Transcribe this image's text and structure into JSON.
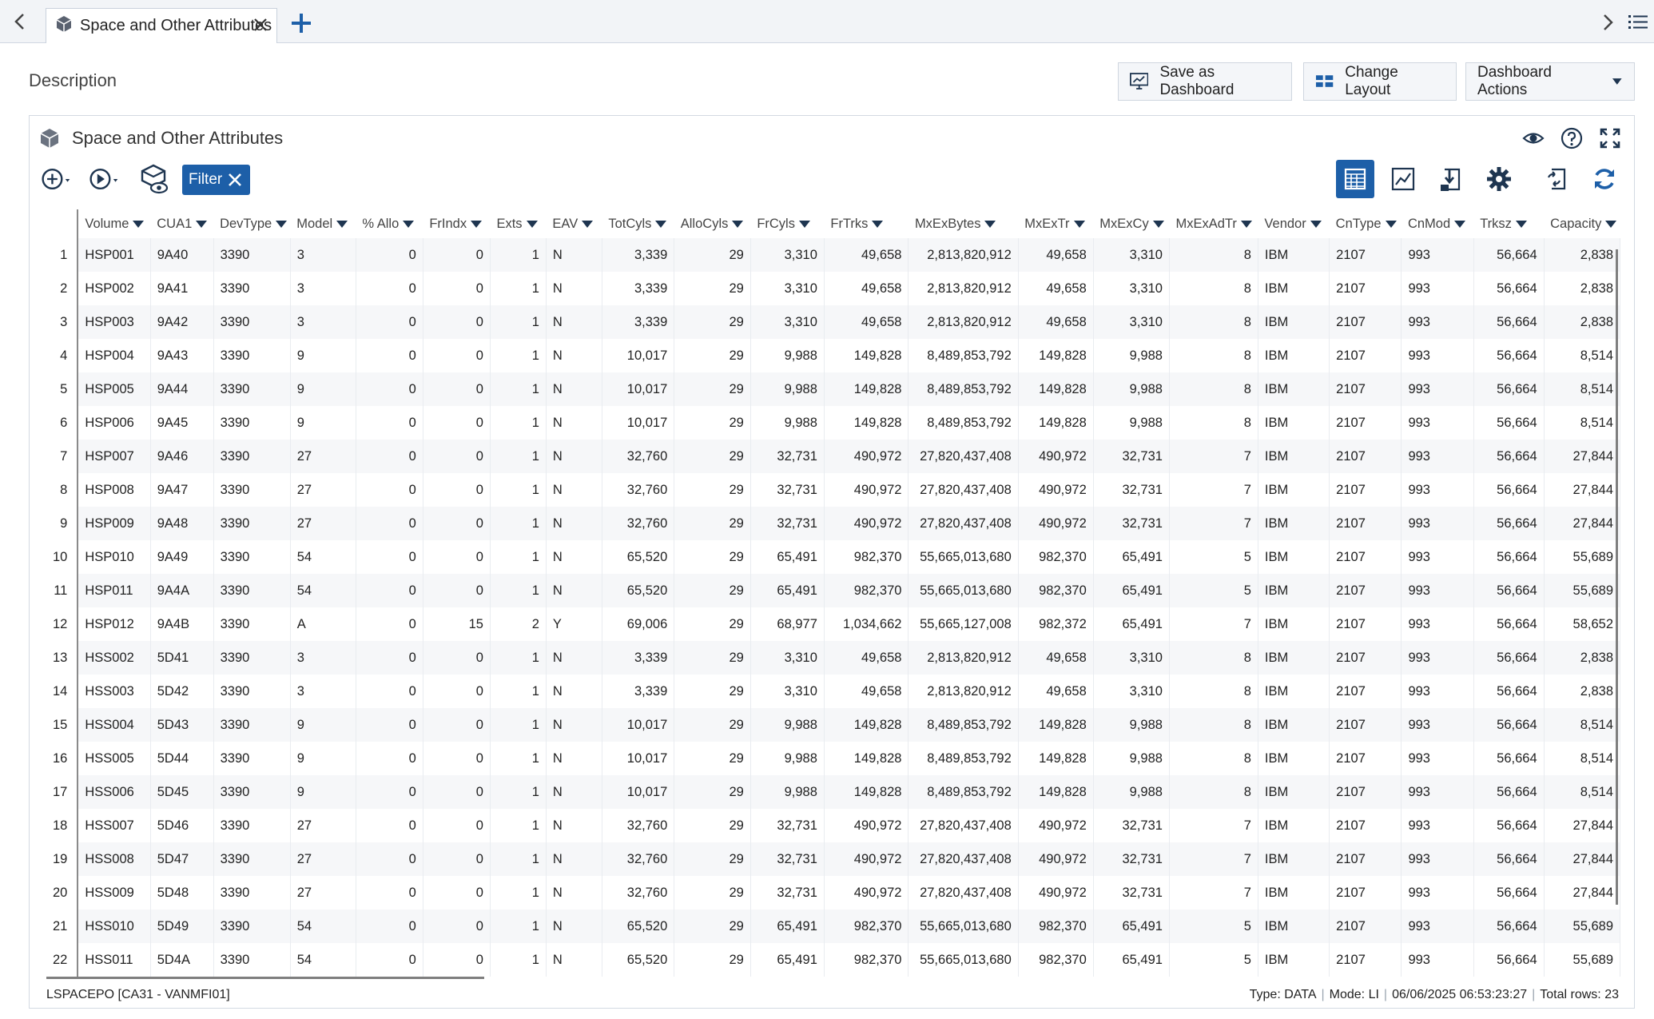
{
  "tab": {
    "title": "Space and Other Attributes"
  },
  "header": {
    "description_label": "Description",
    "save_dashboard_label": "Save as Dashboard",
    "change_layout_label": "Change Layout",
    "dashboard_actions_label": "Dashboard Actions"
  },
  "panel": {
    "title": "Space and Other Attributes",
    "filter_label": "Filter"
  },
  "colors": {
    "accent": "#1d5fa8",
    "icon_dark": "#1e3550"
  },
  "icons": {
    "tab_left": "chevron-left-icon",
    "tab_cube": "cube-icon",
    "tab_close": "close-icon",
    "tab_add": "plus-icon",
    "tab_right": "chevron-right-icon",
    "tab_list": "list-icon",
    "eye": "eye-icon",
    "help": "help-icon",
    "expand": "expand-icon",
    "add": "add-circle-icon",
    "run": "run-circle-icon",
    "view_object": "cube-eye-icon",
    "table_view": "table-icon",
    "chart_view": "chart-icon",
    "export": "export-icon",
    "settings": "gear-icon",
    "sync": "sync-icon",
    "refresh": "refresh-icon"
  },
  "table": {
    "columns": [
      "Volume",
      "CUA1",
      "DevType",
      "Model",
      "% Allo",
      "FrIndx",
      "Exts",
      "EAV",
      "TotCyls",
      "AlloCyls",
      "FrCyls",
      "FrTrks",
      "MxExBytes",
      "MxExTr",
      "MxExCy",
      "MxExAdTr",
      "Vendor",
      "CnType",
      "CnMod",
      "Trksz",
      "Capacity"
    ],
    "rows": [
      [
        "1",
        "HSP001",
        "9A40",
        "3390",
        "3",
        "0",
        "0",
        "1",
        "N",
        "3,339",
        "29",
        "3,310",
        "49,658",
        "2,813,820,912",
        "49,658",
        "3,310",
        "8",
        "IBM",
        "2107",
        "993",
        "56,664",
        "2,838"
      ],
      [
        "2",
        "HSP002",
        "9A41",
        "3390",
        "3",
        "0",
        "0",
        "1",
        "N",
        "3,339",
        "29",
        "3,310",
        "49,658",
        "2,813,820,912",
        "49,658",
        "3,310",
        "8",
        "IBM",
        "2107",
        "993",
        "56,664",
        "2,838"
      ],
      [
        "3",
        "HSP003",
        "9A42",
        "3390",
        "3",
        "0",
        "0",
        "1",
        "N",
        "3,339",
        "29",
        "3,310",
        "49,658",
        "2,813,820,912",
        "49,658",
        "3,310",
        "8",
        "IBM",
        "2107",
        "993",
        "56,664",
        "2,838"
      ],
      [
        "4",
        "HSP004",
        "9A43",
        "3390",
        "9",
        "0",
        "0",
        "1",
        "N",
        "10,017",
        "29",
        "9,988",
        "149,828",
        "8,489,853,792",
        "149,828",
        "9,988",
        "8",
        "IBM",
        "2107",
        "993",
        "56,664",
        "8,514"
      ],
      [
        "5",
        "HSP005",
        "9A44",
        "3390",
        "9",
        "0",
        "0",
        "1",
        "N",
        "10,017",
        "29",
        "9,988",
        "149,828",
        "8,489,853,792",
        "149,828",
        "9,988",
        "8",
        "IBM",
        "2107",
        "993",
        "56,664",
        "8,514"
      ],
      [
        "6",
        "HSP006",
        "9A45",
        "3390",
        "9",
        "0",
        "0",
        "1",
        "N",
        "10,017",
        "29",
        "9,988",
        "149,828",
        "8,489,853,792",
        "149,828",
        "9,988",
        "8",
        "IBM",
        "2107",
        "993",
        "56,664",
        "8,514"
      ],
      [
        "7",
        "HSP007",
        "9A46",
        "3390",
        "27",
        "0",
        "0",
        "1",
        "N",
        "32,760",
        "29",
        "32,731",
        "490,972",
        "27,820,437,408",
        "490,972",
        "32,731",
        "7",
        "IBM",
        "2107",
        "993",
        "56,664",
        "27,844"
      ],
      [
        "8",
        "HSP008",
        "9A47",
        "3390",
        "27",
        "0",
        "0",
        "1",
        "N",
        "32,760",
        "29",
        "32,731",
        "490,972",
        "27,820,437,408",
        "490,972",
        "32,731",
        "7",
        "IBM",
        "2107",
        "993",
        "56,664",
        "27,844"
      ],
      [
        "9",
        "HSP009",
        "9A48",
        "3390",
        "27",
        "0",
        "0",
        "1",
        "N",
        "32,760",
        "29",
        "32,731",
        "490,972",
        "27,820,437,408",
        "490,972",
        "32,731",
        "7",
        "IBM",
        "2107",
        "993",
        "56,664",
        "27,844"
      ],
      [
        "10",
        "HSP010",
        "9A49",
        "3390",
        "54",
        "0",
        "0",
        "1",
        "N",
        "65,520",
        "29",
        "65,491",
        "982,370",
        "55,665,013,680",
        "982,370",
        "65,491",
        "5",
        "IBM",
        "2107",
        "993",
        "56,664",
        "55,689"
      ],
      [
        "11",
        "HSP011",
        "9A4A",
        "3390",
        "54",
        "0",
        "0",
        "1",
        "N",
        "65,520",
        "29",
        "65,491",
        "982,370",
        "55,665,013,680",
        "982,370",
        "65,491",
        "5",
        "IBM",
        "2107",
        "993",
        "56,664",
        "55,689"
      ],
      [
        "12",
        "HSP012",
        "9A4B",
        "3390",
        "A",
        "0",
        "15",
        "2",
        "Y",
        "69,006",
        "29",
        "68,977",
        "1,034,662",
        "55,665,127,008",
        "982,372",
        "65,491",
        "7",
        "IBM",
        "2107",
        "993",
        "56,664",
        "58,652"
      ],
      [
        "13",
        "HSS002",
        "5D41",
        "3390",
        "3",
        "0",
        "0",
        "1",
        "N",
        "3,339",
        "29",
        "3,310",
        "49,658",
        "2,813,820,912",
        "49,658",
        "3,310",
        "8",
        "IBM",
        "2107",
        "993",
        "56,664",
        "2,838"
      ],
      [
        "14",
        "HSS003",
        "5D42",
        "3390",
        "3",
        "0",
        "0",
        "1",
        "N",
        "3,339",
        "29",
        "3,310",
        "49,658",
        "2,813,820,912",
        "49,658",
        "3,310",
        "8",
        "IBM",
        "2107",
        "993",
        "56,664",
        "2,838"
      ],
      [
        "15",
        "HSS004",
        "5D43",
        "3390",
        "9",
        "0",
        "0",
        "1",
        "N",
        "10,017",
        "29",
        "9,988",
        "149,828",
        "8,489,853,792",
        "149,828",
        "9,988",
        "8",
        "IBM",
        "2107",
        "993",
        "56,664",
        "8,514"
      ],
      [
        "16",
        "HSS005",
        "5D44",
        "3390",
        "9",
        "0",
        "0",
        "1",
        "N",
        "10,017",
        "29",
        "9,988",
        "149,828",
        "8,489,853,792",
        "149,828",
        "9,988",
        "8",
        "IBM",
        "2107",
        "993",
        "56,664",
        "8,514"
      ],
      [
        "17",
        "HSS006",
        "5D45",
        "3390",
        "9",
        "0",
        "0",
        "1",
        "N",
        "10,017",
        "29",
        "9,988",
        "149,828",
        "8,489,853,792",
        "149,828",
        "9,988",
        "8",
        "IBM",
        "2107",
        "993",
        "56,664",
        "8,514"
      ],
      [
        "18",
        "HSS007",
        "5D46",
        "3390",
        "27",
        "0",
        "0",
        "1",
        "N",
        "32,760",
        "29",
        "32,731",
        "490,972",
        "27,820,437,408",
        "490,972",
        "32,731",
        "7",
        "IBM",
        "2107",
        "993",
        "56,664",
        "27,844"
      ],
      [
        "19",
        "HSS008",
        "5D47",
        "3390",
        "27",
        "0",
        "0",
        "1",
        "N",
        "32,760",
        "29",
        "32,731",
        "490,972",
        "27,820,437,408",
        "490,972",
        "32,731",
        "7",
        "IBM",
        "2107",
        "993",
        "56,664",
        "27,844"
      ],
      [
        "20",
        "HSS009",
        "5D48",
        "3390",
        "27",
        "0",
        "0",
        "1",
        "N",
        "32,760",
        "29",
        "32,731",
        "490,972",
        "27,820,437,408",
        "490,972",
        "32,731",
        "7",
        "IBM",
        "2107",
        "993",
        "56,664",
        "27,844"
      ],
      [
        "21",
        "HSS010",
        "5D49",
        "3390",
        "54",
        "0",
        "0",
        "1",
        "N",
        "65,520",
        "29",
        "65,491",
        "982,370",
        "55,665,013,680",
        "982,370",
        "65,491",
        "5",
        "IBM",
        "2107",
        "993",
        "56,664",
        "55,689"
      ],
      [
        "22",
        "HSS011",
        "5D4A",
        "3390",
        "54",
        "0",
        "0",
        "1",
        "N",
        "65,520",
        "29",
        "65,491",
        "982,370",
        "55,665,013,680",
        "982,370",
        "65,491",
        "5",
        "IBM",
        "2107",
        "993",
        "56,664",
        "55,689"
      ]
    ]
  },
  "footer": {
    "source": "LSPACEPO [CA31 - VANMFI01]",
    "type": "Type: DATA",
    "mode": "Mode: LI",
    "timestamp": "06/06/2025 06:53:23:27",
    "total_rows": "Total rows: 23"
  }
}
